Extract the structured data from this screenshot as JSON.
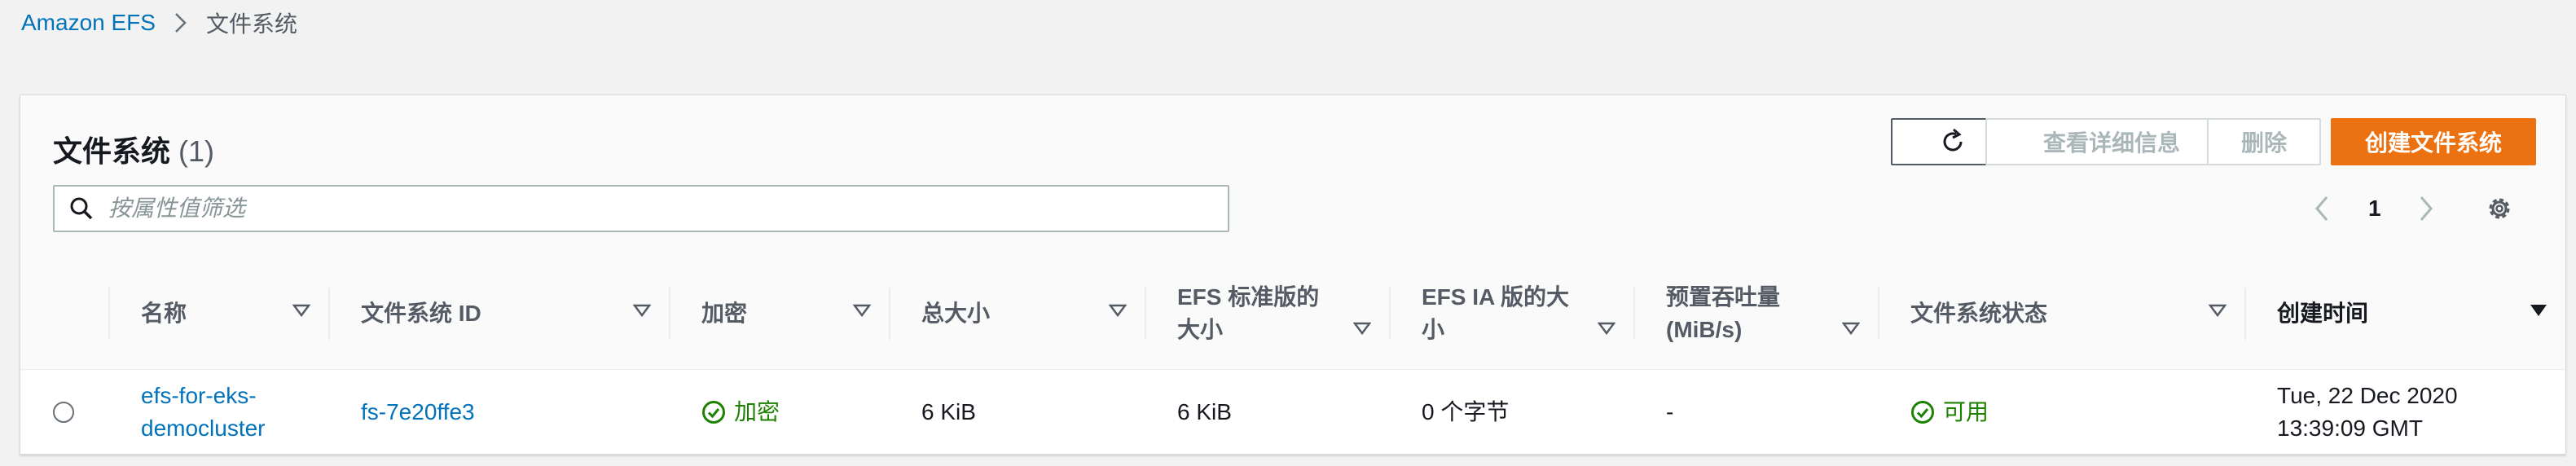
{
  "breadcrumb": {
    "root": "Amazon EFS",
    "current": "文件系统"
  },
  "panel": {
    "title": "文件系统",
    "count": "(1)",
    "buttons": {
      "details": "查看详细信息",
      "delete": "删除",
      "create": "创建文件系统"
    },
    "search_placeholder": "按属性值筛选",
    "page": "1"
  },
  "columns": [
    "名称",
    "文件系统 ID",
    "加密",
    "总大小",
    [
      "EFS 标准版的",
      "大小"
    ],
    [
      "EFS IA 版的大",
      "小"
    ],
    [
      "预置吞吐量",
      "(MiB/s)"
    ],
    "文件系统状态",
    "创建时间"
  ],
  "rows": [
    {
      "name": [
        "efs-for-eks-",
        "democluster"
      ],
      "fs_id": "fs-7e20ffe3",
      "encryption": "加密",
      "total_size": "6 KiB",
      "standard_size": "6 KiB",
      "ia_size": "0 个字节",
      "throughput": "-",
      "state": "可用",
      "created": [
        "Tue, 22 Dec 2020",
        "13:39:09 GMT"
      ]
    }
  ],
  "colors": {
    "link": "#0073bb",
    "primary": "#ec7211",
    "success": "#1d8102",
    "border": "#d5dbdb"
  },
  "icons": [
    "chevron-right-icon",
    "refresh-icon",
    "search-icon",
    "chevron-left-icon",
    "gear-icon",
    "sort-icon",
    "check-circle-icon"
  ]
}
